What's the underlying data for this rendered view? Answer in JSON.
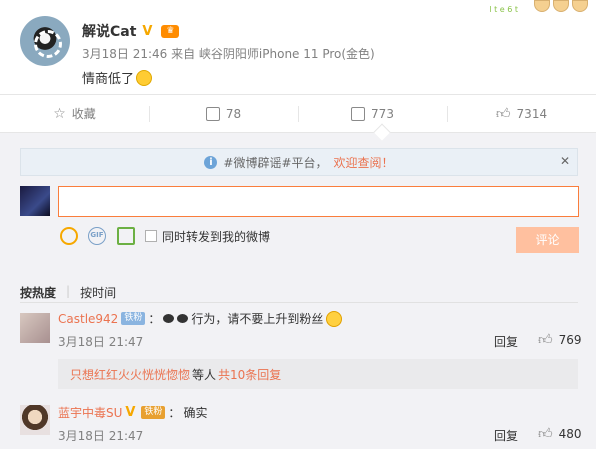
{
  "post": {
    "author": "解说Cat",
    "verified_badge": "V",
    "meta": "3月18日 21:46 来自 峡谷阴阳师iPhone 11 Pro(金色)",
    "text": "情商低了",
    "deco_text": "l t e 6 t"
  },
  "actions": {
    "favorite": "收藏",
    "forward": "78",
    "comment": "773",
    "like": "7314"
  },
  "composer": {
    "notice_prefix": "#微博辟谣#平台，",
    "notice_link": "欢迎查阅！",
    "close": "✕",
    "forward_also": "同时转发到我的微博",
    "submit": "评论",
    "gif_label": "GIF"
  },
  "sort": {
    "by_hot": "按热度",
    "by_time": "按时间",
    "separator": "|"
  },
  "comments": [
    {
      "name": "Castle942",
      "badge": "铁粉",
      "text_pre": "：",
      "text": "行为，请不要上升到粉丝",
      "time": "3月18日 21:47",
      "reply": "回复",
      "likes": "769",
      "sub": {
        "names": "只想红红火火恍恍惚惚",
        "mid": "等人",
        "more": "共10条回复"
      }
    },
    {
      "name": "蓝宇中毒SU",
      "badge": "铁粉",
      "text_pre": "：",
      "text": "确实",
      "time": "3月18日 21:47",
      "reply": "回复",
      "likes": "480"
    }
  ],
  "colors": {
    "accent": "#eb7350",
    "input_border": "#fa7d3c",
    "submit_bg": "#ffc09f",
    "notice_bg": "#eaf0f6"
  }
}
